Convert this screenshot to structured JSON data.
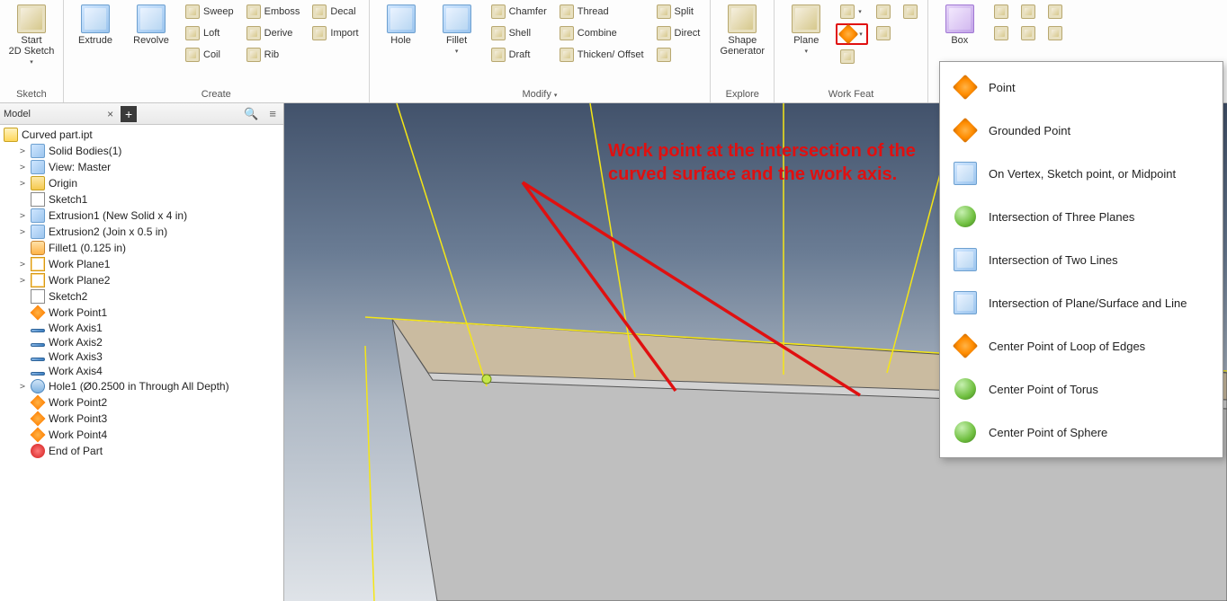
{
  "ribbon": {
    "groups": {
      "sketch": {
        "label": "Sketch",
        "start_sketch": "Start\n2D Sketch"
      },
      "create": {
        "label": "Create",
        "extrude": "Extrude",
        "revolve": "Revolve",
        "sweep": "Sweep",
        "loft": "Loft",
        "coil": "Coil",
        "emboss": "Emboss",
        "derive": "Derive",
        "rib": "Rib",
        "decal": "Decal",
        "import": "Import"
      },
      "modify": {
        "label": "Modify",
        "hole": "Hole",
        "fillet": "Fillet",
        "chamfer": "Chamfer",
        "shell": "Shell",
        "draft": "Draft",
        "thread": "Thread",
        "combine": "Combine",
        "thicken": "Thicken/ Offset",
        "split": "Split",
        "direct": "Direct"
      },
      "explore": {
        "label": "Explore",
        "shape_gen": "Shape\nGenerator"
      },
      "workfeat": {
        "label": "Work Feat",
        "plane": "Plane"
      },
      "box_group": {
        "label": "Box"
      }
    },
    "arrow": "▾"
  },
  "browser": {
    "title": "Model",
    "root": "Curved part.ipt",
    "items": [
      {
        "icon": "cube",
        "text": "Solid Bodies(1)",
        "tw": ">",
        "depth": 1
      },
      {
        "icon": "cube",
        "text": "View: Master",
        "tw": ">",
        "depth": 1
      },
      {
        "icon": "folder",
        "text": "Origin",
        "tw": ">",
        "depth": 1
      },
      {
        "icon": "sketch",
        "text": "Sketch1",
        "tw": "",
        "depth": 1
      },
      {
        "icon": "cube",
        "text": "Extrusion1 (New Solid x 4 in)",
        "tw": ">",
        "depth": 1
      },
      {
        "icon": "cube",
        "text": "Extrusion2 (Join x 0.5 in)",
        "tw": ">",
        "depth": 1
      },
      {
        "icon": "fillet",
        "text": "Fillet1 (0.125 in)",
        "tw": "",
        "depth": 1
      },
      {
        "icon": "plane",
        "text": "Work Plane1",
        "tw": ">",
        "depth": 1
      },
      {
        "icon": "plane",
        "text": "Work Plane2",
        "tw": ">",
        "depth": 1
      },
      {
        "icon": "sketch",
        "text": "Sketch2",
        "tw": "",
        "depth": 1
      },
      {
        "icon": "point",
        "text": "Work Point1",
        "tw": "",
        "depth": 1
      },
      {
        "icon": "axis",
        "text": "Work Axis1",
        "tw": "",
        "depth": 1
      },
      {
        "icon": "axis",
        "text": "Work Axis2",
        "tw": "",
        "depth": 1
      },
      {
        "icon": "axis",
        "text": "Work Axis3",
        "tw": "",
        "depth": 1
      },
      {
        "icon": "axis",
        "text": "Work Axis4",
        "tw": "",
        "depth": 1
      },
      {
        "icon": "hole",
        "text": "Hole1 (Ø0.2500 in Through All Depth)",
        "tw": ">",
        "depth": 1
      },
      {
        "icon": "point",
        "text": "Work Point2",
        "tw": "",
        "depth": 1
      },
      {
        "icon": "point",
        "text": "Work Point3",
        "tw": "",
        "depth": 1
      },
      {
        "icon": "point",
        "text": "Work Point4",
        "tw": "",
        "depth": 1
      },
      {
        "icon": "end",
        "text": "End of Part",
        "tw": "",
        "depth": 1
      }
    ]
  },
  "viewport": {
    "annotation_l1": "Work point at the intersection of the",
    "annotation_l2": "curved surface and the work axis."
  },
  "menu": {
    "items": [
      {
        "icon": "orange-pt",
        "label": "Point"
      },
      {
        "icon": "orange-pt",
        "label": "Grounded Point"
      },
      {
        "icon": "cube",
        "label": "On Vertex, Sketch point, or Midpoint"
      },
      {
        "icon": "green-sphere",
        "label": "Intersection of Three Planes"
      },
      {
        "icon": "cube",
        "label": "Intersection of Two Lines"
      },
      {
        "icon": "cube",
        "label": "Intersection of Plane/Surface and Line"
      },
      {
        "icon": "orange-pt",
        "label": "Center Point of Loop of Edges"
      },
      {
        "icon": "green-sphere",
        "label": "Center Point of Torus"
      },
      {
        "icon": "green-sphere",
        "label": "Center Point of Sphere"
      }
    ]
  }
}
